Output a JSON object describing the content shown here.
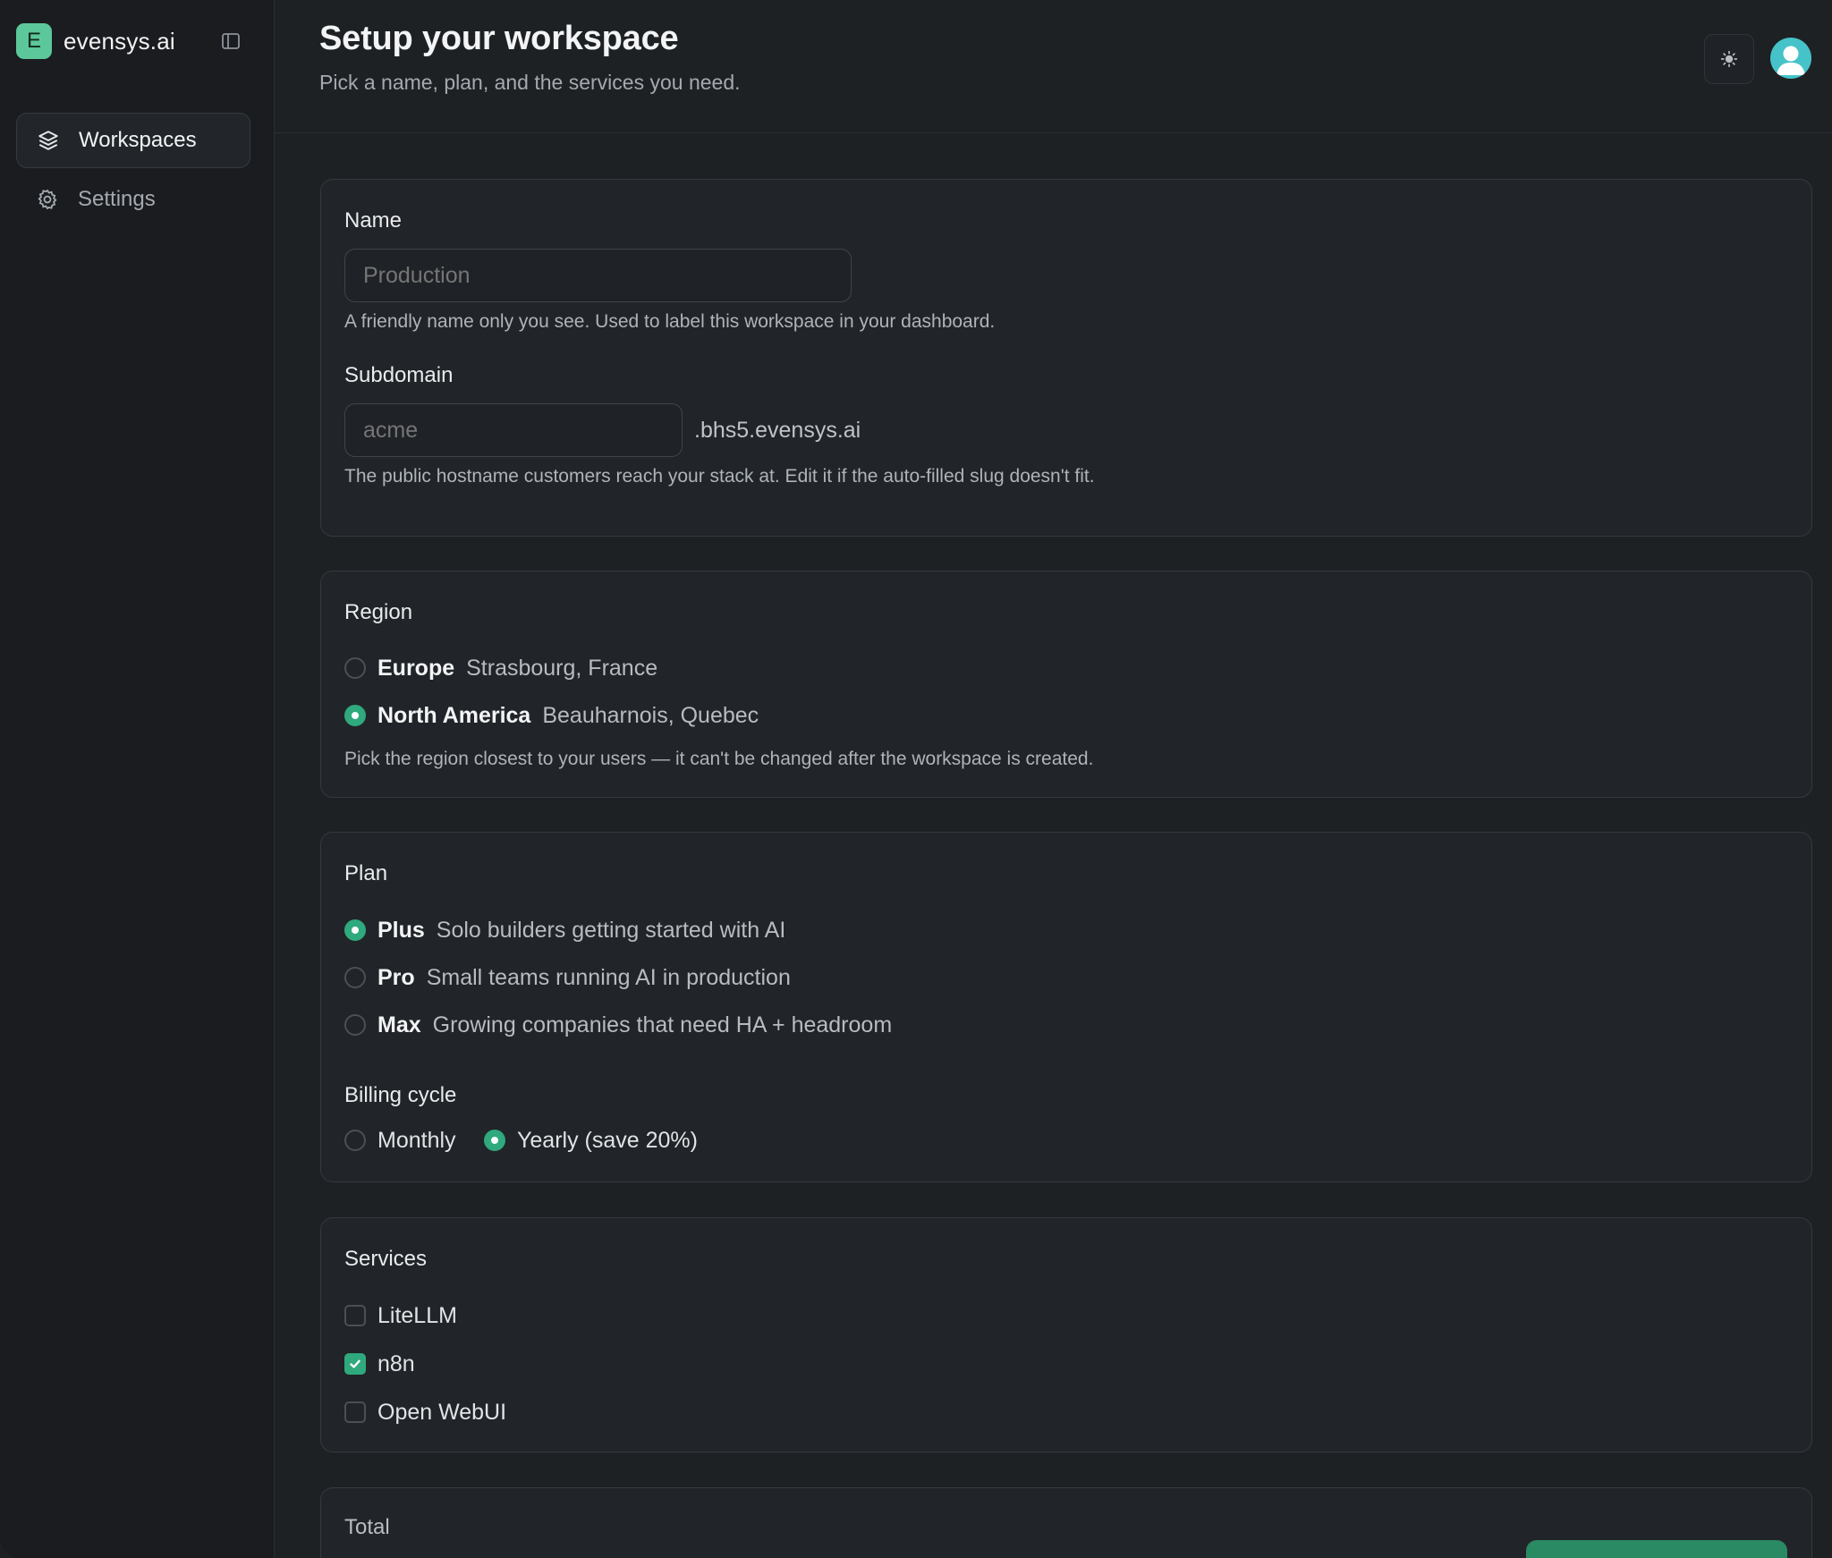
{
  "colors": {
    "accent": "#2fa97d",
    "brand": "#5cc79a",
    "background": "#1e2124",
    "sidebar": "#1a1c1f"
  },
  "sidebar": {
    "brand_initial": "E",
    "brand_name": "evensys.ai",
    "collapse_icon": "sidebar-toggle-icon",
    "items": [
      {
        "label": "Workspaces",
        "icon": "layers-icon",
        "active": true
      },
      {
        "label": "Settings",
        "icon": "gear-icon",
        "active": false
      }
    ]
  },
  "header": {
    "title": "Setup your workspace",
    "subtitle": "Pick a name, plan, and the services you need.",
    "theme_icon": "sun-icon",
    "avatar_icon": "user-avatar-icon"
  },
  "form": {
    "name": {
      "label": "Name",
      "placeholder": "Production",
      "help": "A friendly name only you see. Used to label this workspace in your dashboard."
    },
    "subdomain": {
      "label": "Subdomain",
      "placeholder": "acme",
      "suffix": ".bhs5.evensys.ai",
      "help": "The public hostname customers reach your stack at. Edit it if the auto-filled slug doesn't fit."
    },
    "region": {
      "label": "Region",
      "options": [
        {
          "title": "Europe",
          "desc": "Strasbourg, France",
          "selected": false
        },
        {
          "title": "North America",
          "desc": "Beauharnois, Quebec",
          "selected": true
        }
      ],
      "help": "Pick the region closest to your users — it can't be changed after the workspace is created."
    },
    "plan": {
      "label": "Plan",
      "options": [
        {
          "title": "Plus",
          "desc": "Solo builders getting started with AI",
          "selected": true
        },
        {
          "title": "Pro",
          "desc": "Small teams running AI in production",
          "selected": false
        },
        {
          "title": "Max",
          "desc": "Growing companies that need HA + headroom",
          "selected": false
        }
      ]
    },
    "billing": {
      "label": "Billing cycle",
      "options": [
        {
          "label": "Monthly",
          "selected": false
        },
        {
          "label": "Yearly (save 20%)",
          "selected": true
        }
      ]
    },
    "services": {
      "label": "Services",
      "items": [
        {
          "label": "LiteLLM",
          "checked": false
        },
        {
          "label": "n8n",
          "checked": true
        },
        {
          "label": "Open WebUI",
          "checked": false
        }
      ]
    },
    "total": {
      "label": "Total"
    }
  }
}
